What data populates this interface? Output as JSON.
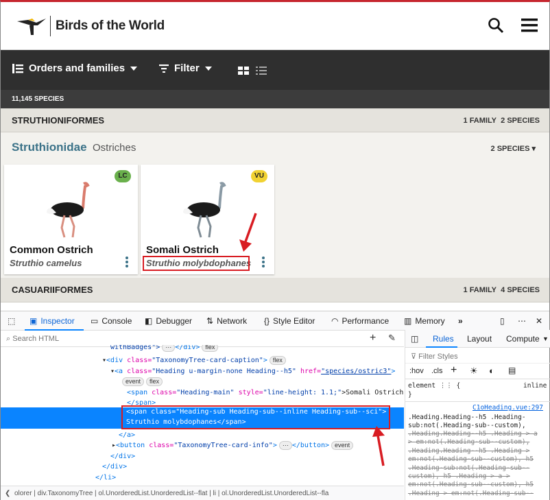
{
  "header": {
    "logo_text": "Birds of the World",
    "search_icon": "search-icon",
    "menu_icon": "hamburger-menu-icon"
  },
  "nav": {
    "orders_label": "Orders and families",
    "filter_label": "Filter"
  },
  "species_count": "11,145 SPECIES",
  "orders": [
    {
      "name": "STRUTHIONIFORMES",
      "families": "1 FAMILY",
      "species": "2 SPECIES"
    },
    {
      "name": "CASUARIIFORMES",
      "families": "1 FAMILY",
      "species": "4 SPECIES"
    }
  ],
  "family": {
    "scientific": "Struthionidae",
    "common": "Ostriches",
    "species_toggle": "2 SPECIES"
  },
  "cards": [
    {
      "common": "Common Ostrich",
      "scientific": "Struthio camelus",
      "status": "LC",
      "status_color": "#6ab04c"
    },
    {
      "common": "Somali Ostrich",
      "scientific": "Struthio molybdophanes",
      "status": "VU",
      "status_color": "#f1d232"
    }
  ],
  "devtools": {
    "tabs": [
      "Inspector",
      "Console",
      "Debugger",
      "Network",
      "Style Editor",
      "Performance",
      "Memory"
    ],
    "search_placeholder": "Search HTML",
    "code": {
      "l0_a": "withBadges\">",
      "l0_b": "</div>",
      "l0_c": "flex",
      "l1_tag": "<div ",
      "l1_attr": "class=",
      "l1_val": "\"TaxonomyTree-card-caption\"",
      "l1_end": ">",
      "l1_pill": "flex",
      "l2_tag": "<a ",
      "l2_attr": "class=",
      "l2_val": "\"Heading u-margin-none Heading--h5\"",
      "l2_attr2": " href=",
      "l2_val2": "\"species/ostric3\"",
      "l2_end": ">",
      "l3_p1": "event",
      "l3_p2": "flex",
      "l4_tag": "<span ",
      "l4_attr": "class=",
      "l4_val": "\"Heading-main\"",
      "l4_attr2": " style=",
      "l4_val2": "\"line-height: 1.1;\"",
      "l4_end": ">Somali Ostrich",
      "l5": "</span>",
      "l6": "<span class=\"Heading-sub Heading-sub--inline Heading-sub--sci\">",
      "l7": "Struthio molybdophanes</span>",
      "l8": "</a>",
      "l9_tag": "<button ",
      "l9_attr": "class=",
      "l9_val": "\"TaxonomyTree-card-info\"",
      "l9_end": ">",
      "l9_close": "</button>",
      "l9_pill": "event",
      "l10": "</div>",
      "l11": "</div>",
      "l12": "</li>"
    },
    "breadcrumb": "olorer  |  div.TaxonomyTree  |  ol.UnorderedList.UnorderedList--flat  |  li  |  ol.UnorderedList.UnorderedList--fla",
    "side_tabs": [
      "Rules",
      "Layout",
      "Compute"
    ],
    "filter_styles": "Filter Styles",
    "hov": ":hov",
    ".cls": ".cls",
    "element_rule": "element",
    "element_brace": "{",
    "inline_label": "inline",
    "close_brace": "}",
    "source_link": "C1oHeading.vue:297",
    "rules": [
      ".Heading.Heading--h5 .Heading-",
      "sub:not(.Heading-sub--custom),",
      ".Heading.Heading--h5 .Heading > a",
      "> em:not(.Heading-sub--custom),",
      ".Heading.Heading--h5 .Heading >",
      "em:not(.Heading-sub--custom), h5",
      ".Heading-sub:not(.Heading-sub--",
      "custom), h5 .Heading > a >",
      "em:not(.Heading-sub--custom), h5",
      ".Heading > em:not(.Heading-sub--"
    ]
  }
}
